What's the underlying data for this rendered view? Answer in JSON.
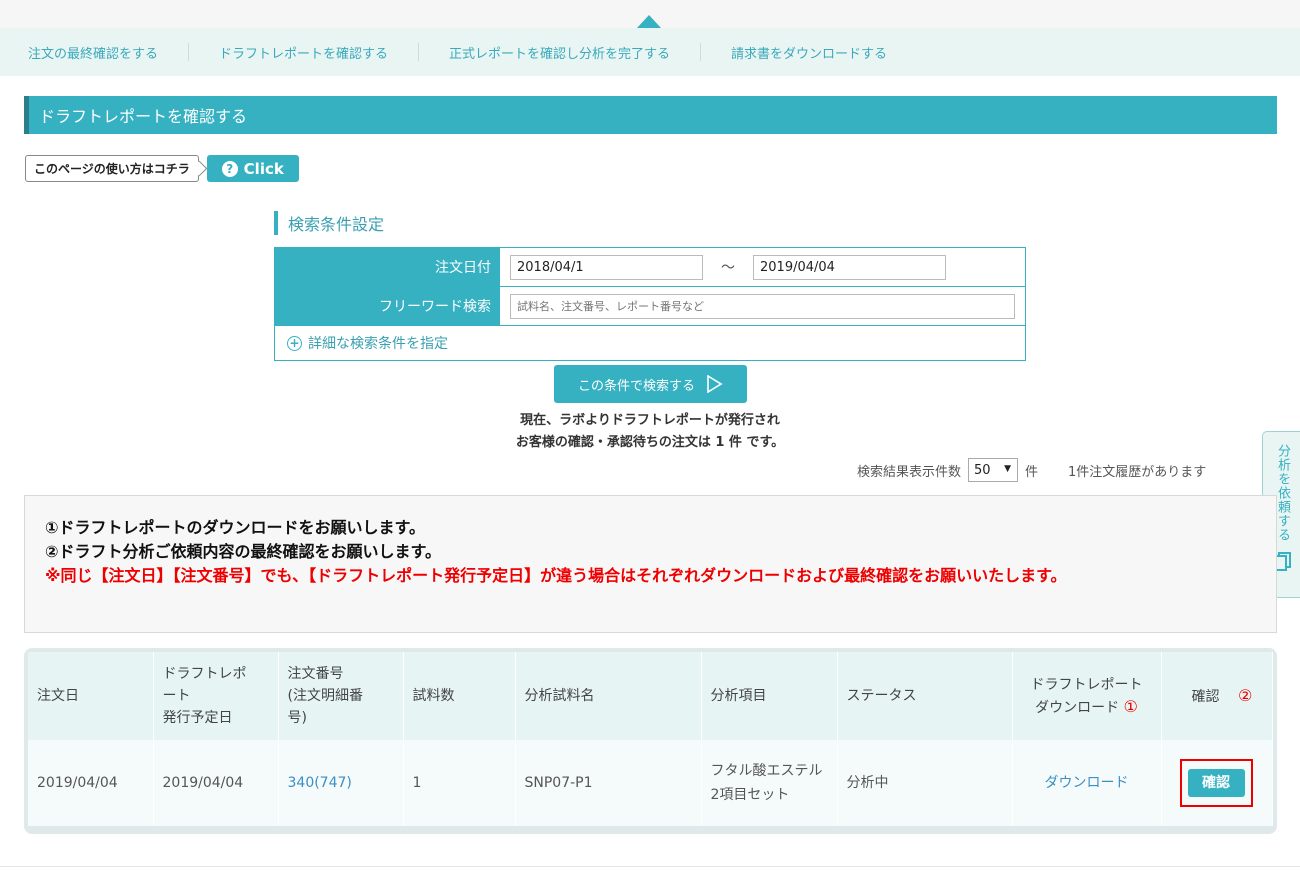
{
  "steps": [
    {
      "label": "注文の最終確認をする"
    },
    {
      "label": "ドラフトレポートを確認する"
    },
    {
      "label": "正式レポートを確認し分析を完了する"
    },
    {
      "label": "請求書をダウンロードする"
    }
  ],
  "section_title": "ドラフトレポートを確認する",
  "howto": {
    "label": "このページの使い方はコチラ",
    "button": "Click",
    "icon": "question-icon"
  },
  "search": {
    "title": "検索条件設定",
    "order_date_label": "注文日付",
    "date_from": "2018/04/1",
    "tilde": "〜",
    "date_to": "2019/04/04",
    "freeword_label": "フリーワード検索",
    "freeword_placeholder": "試料名、注文番号、レポート番号など",
    "advanced_link": "詳細な検索条件を指定",
    "submit_label": "この条件で検索する"
  },
  "status": {
    "line1": "現在、ラボよりドラフトレポートが発行され",
    "line2": "お客様の確認・承認待ちの注文は 1 件 です。"
  },
  "results_count": {
    "label": "検索結果表示件数",
    "value": "50",
    "unit": "件",
    "history": "1件注文履歴があります"
  },
  "side_tab": {
    "label": "分析を依頼する",
    "icon": "document-copy-icon"
  },
  "notice": {
    "line1": "①ドラフトレポートのダウンロードをお願いします。",
    "line2": "②ドラフト分析ご依頼内容の最終確認をお願いします。",
    "warning": "※同じ【注文日】【注文番号】でも、【ドラフトレポート発行予定日】が違う場合はそれぞれダウンロードおよび最終確認をお願いいたします。"
  },
  "table": {
    "headers": {
      "order_date": "注文日",
      "draft_date": "ドラフトレポート\n発行予定日",
      "order_no": "注文番号\n(注文明細番号)",
      "sample_count": "試料数",
      "sample_name": "分析試料名",
      "analysis_item": "分析項目",
      "status": "ステータス",
      "download": "ドラフトレポート\nダウンロード",
      "download_marker": "①",
      "confirm": "確認",
      "confirm_marker": "②"
    },
    "rows": [
      {
        "order_date": "2019/04/04",
        "draft_date": "2019/04/04",
        "order_no": "340(747)",
        "sample_count": "1",
        "sample_name": "SNP07-P1",
        "analysis_item": "フタル酸エステル　2項目セット",
        "status": "分析中",
        "download": "ダウンロード",
        "confirm": "確認"
      }
    ]
  },
  "colors": {
    "accent": "#35b1c2",
    "highlight": "#e00000",
    "link": "#3a8fc4"
  }
}
